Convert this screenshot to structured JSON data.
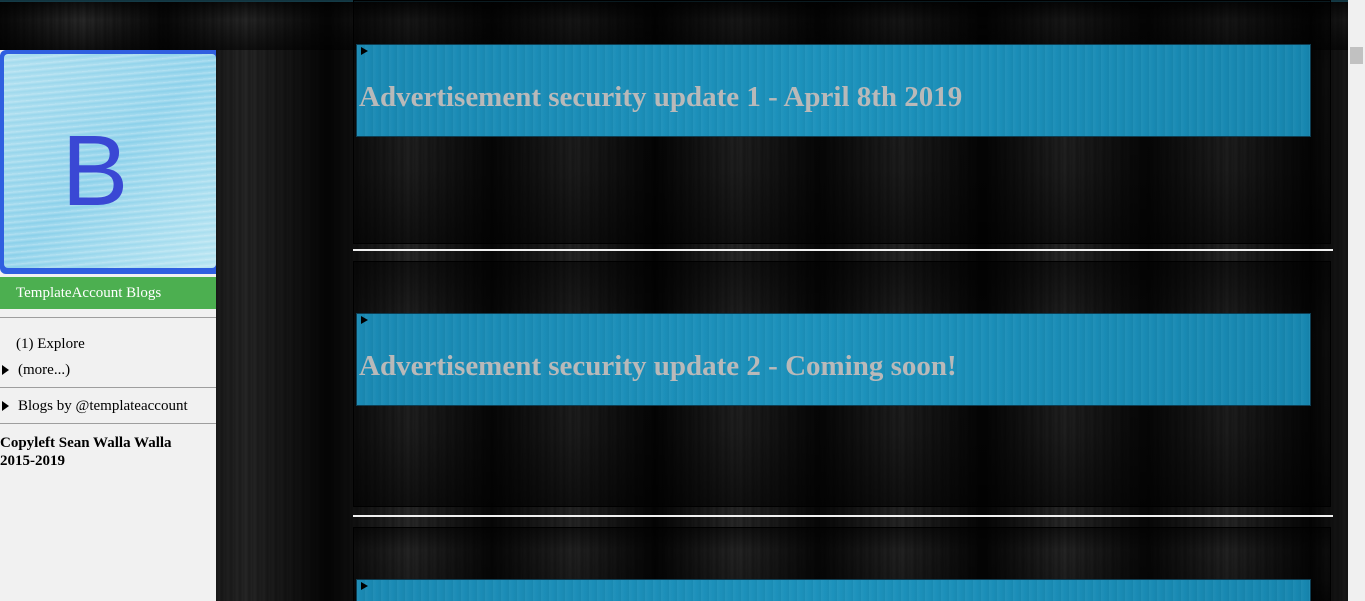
{
  "sidebar": {
    "logo_letter": "B",
    "blog_title": "TemplateAccount Blogs",
    "explore": "(1) Explore",
    "more": "(more...)",
    "blogs_by": "Blogs by @templateaccount",
    "copyleft": "Copyleft Sean Walla Walla 2015-2019"
  },
  "posts": [
    {
      "title": "Advertisement security update 1 - April 8th 2019"
    },
    {
      "title": "Advertisement security update 2 - Coming soon!"
    },
    {
      "title": ""
    }
  ],
  "colors": {
    "accent_green": "#4caf50",
    "banner_blue": "#1a8ab4",
    "logo_letter": "#3a48d4",
    "title_text": "#b9b9b9"
  }
}
